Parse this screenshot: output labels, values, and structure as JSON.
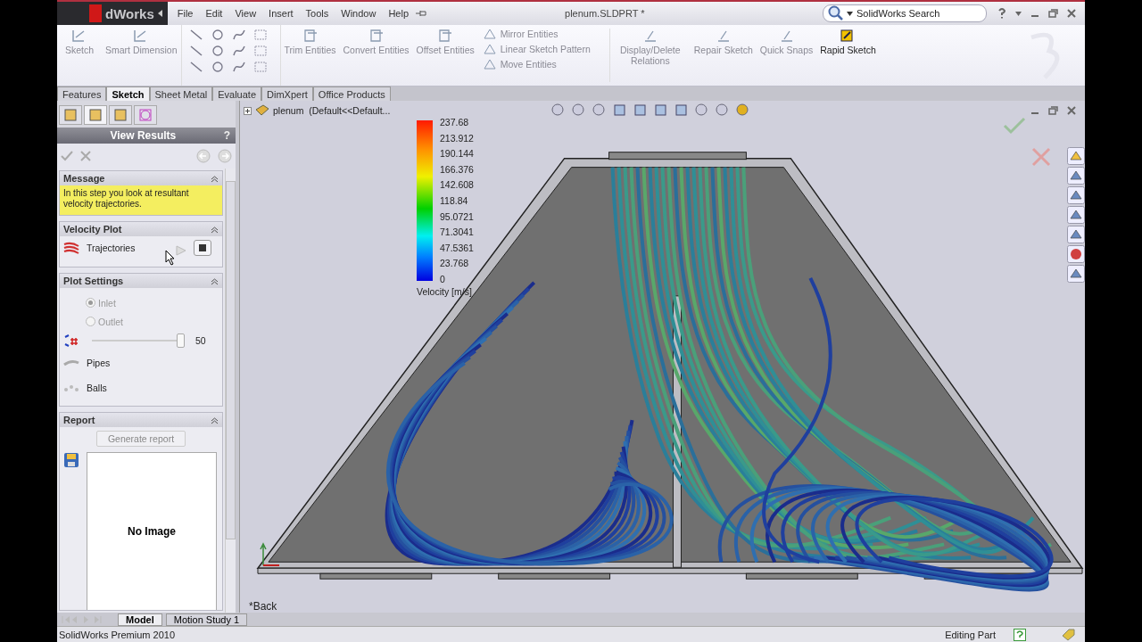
{
  "app": {
    "logo_text": "dWorks",
    "document_title": "plenum.SLDPRT *"
  },
  "menu": [
    "File",
    "Edit",
    "View",
    "Insert",
    "Tools",
    "Window",
    "Help"
  ],
  "search": {
    "placeholder": "SolidWorks Search"
  },
  "ribbon": {
    "left": [
      {
        "label": "Sketch",
        "disabled": true
      },
      {
        "label": "Smart Dimension",
        "disabled": true
      }
    ],
    "middle": [
      {
        "label": "Trim Entities",
        "disabled": true
      },
      {
        "label": "Convert Entities",
        "disabled": true
      },
      {
        "label": "Offset Entities",
        "disabled": true
      }
    ],
    "list": [
      {
        "label": "Mirror Entities",
        "disabled": true
      },
      {
        "label": "Linear Sketch Pattern",
        "disabled": true
      },
      {
        "label": "Move Entities",
        "disabled": true
      }
    ],
    "right": [
      {
        "label": "Display/Delete Relations",
        "disabled": true
      },
      {
        "label": "Repair Sketch",
        "disabled": true
      },
      {
        "label": "Quick Snaps",
        "disabled": true
      },
      {
        "label": "Rapid Sketch",
        "disabled": false
      }
    ]
  },
  "tabs": [
    {
      "label": "Features",
      "selected": false
    },
    {
      "label": "Sketch",
      "selected": true
    },
    {
      "label": "Sheet Metal",
      "selected": false
    },
    {
      "label": "Evaluate",
      "selected": false
    },
    {
      "label": "DimXpert",
      "selected": false
    },
    {
      "label": "Office Products",
      "selected": false
    }
  ],
  "panel": {
    "title": "View Results",
    "help": "?",
    "message": {
      "title": "Message",
      "text": "In this step you look at resultant velocity trajectories."
    },
    "velocity_plot": {
      "title": "Velocity Plot",
      "item": "Trajectories"
    },
    "plot_settings": {
      "title": "Plot Settings",
      "options": [
        {
          "label": "Inlet",
          "selected": true
        },
        {
          "label": "Outlet",
          "selected": false
        }
      ],
      "slider": {
        "level": 0.95,
        "reading": "50"
      },
      "modes": [
        "Pipes",
        "Balls"
      ]
    },
    "report": {
      "title": "Report",
      "button": "Generate report",
      "image_text": "No Image"
    }
  },
  "tree": {
    "root": "plenum  (Default<<Default..."
  },
  "legend": {
    "labels": [
      "237.68",
      "213.912",
      "190.144",
      "166.376",
      "142.608",
      "118.84",
      "95.0721",
      "71.3041",
      "47.5361",
      "23.768",
      "0"
    ],
    "title": "Velocity [m/s]"
  },
  "view_label": "*Back",
  "bottom_tabs": [
    {
      "label": "Model",
      "selected": true
    },
    {
      "label": "Motion Study 1",
      "selected": false
    }
  ],
  "status_bar": {
    "product": "SolidWorks Premium 2010",
    "mode": "Editing Part"
  }
}
